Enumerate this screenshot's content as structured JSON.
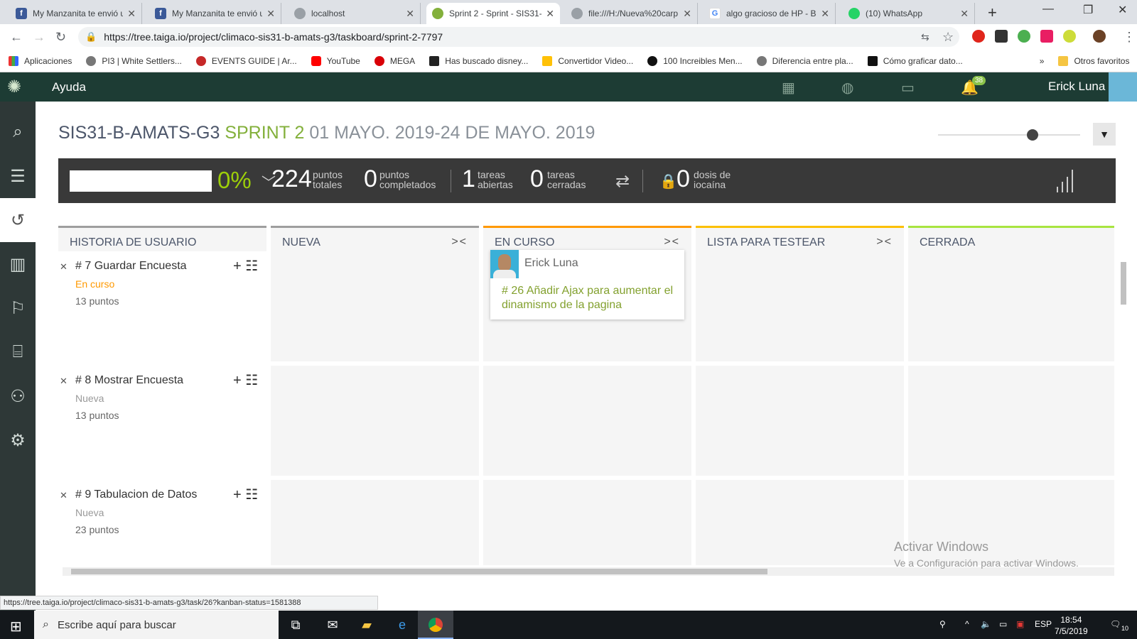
{
  "browser": {
    "tabs": [
      {
        "title": "My Manzanita te envió u",
        "icon": "facebook-icon",
        "active": false
      },
      {
        "title": "My Manzanita te envió u",
        "icon": "facebook-icon",
        "active": false
      },
      {
        "title": "localhost",
        "icon": "globe-icon",
        "active": false
      },
      {
        "title": "Sprint 2 - Sprint - SIS31-",
        "icon": "taiga-icon",
        "active": true
      },
      {
        "title": "file:///H:/Nueva%20carp",
        "icon": "globe-icon",
        "active": false
      },
      {
        "title": "algo gracioso de HP - Bu",
        "icon": "google-icon",
        "active": false
      },
      {
        "title": "(10) WhatsApp",
        "icon": "whatsapp-icon",
        "active": false
      }
    ],
    "url": "https://tree.taiga.io/project/climaco-sis31-b-amats-g3/taskboard/sprint-2-7797",
    "bookmarks": [
      "Aplicaciones",
      "PI3 | White Settlers...",
      "EVENTS GUIDE | Ar...",
      "YouTube",
      "MEGA",
      "Has buscado disney...",
      "Convertidor Video...",
      "100 Increibles Men...",
      "Diferencia entre pla...",
      "Cómo graficar dato..."
    ],
    "other_bookmarks": "Otros favoritos",
    "status_url": "https://tree.taiga.io/project/climaco-sis31-b-amats-g3/task/26?kanban-status=1581388"
  },
  "header": {
    "help": "Ayuda",
    "notifications": "38",
    "user": "Erick Luna"
  },
  "page": {
    "project": "SIS31-B-AMATS-G3",
    "sprint": "SPRINT 2",
    "dates": "01 MAYO. 2019-24 DE MAYO. 2019"
  },
  "summary": {
    "percent": "0%",
    "progress_fraction": 0,
    "total_points": "224",
    "total_label": [
      "puntos",
      "totales"
    ],
    "completed_points": "0",
    "completed_label": [
      "puntos",
      "completados"
    ],
    "open_tasks": "1",
    "open_label": [
      "tareas",
      "abiertas"
    ],
    "closed_tasks": "0",
    "closed_label": [
      "tareas",
      "cerradas"
    ],
    "iocaine": "0",
    "iocaine_label": [
      "dosis de",
      "iocaína"
    ]
  },
  "columns": [
    {
      "name": "HISTORIA DE USUARIO",
      "collapse": "",
      "color": "#9e9e9e"
    },
    {
      "name": "NUEVA",
      "collapse": "><",
      "color": "#9e9e9e"
    },
    {
      "name": "EN CURSO",
      "collapse": "><",
      "color": "#ff9900"
    },
    {
      "name": "LISTA PARA TESTEAR",
      "collapse": "><",
      "color": "#fcc000"
    },
    {
      "name": "CERRADA",
      "collapse": "",
      "color": "#a8e440"
    }
  ],
  "stories": [
    {
      "title": "# 7 Guardar Encuesta",
      "status": "En curso",
      "status_color": "#ff9900",
      "points": "13 puntos"
    },
    {
      "title": "# 8 Mostrar Encuesta",
      "status": "Nueva",
      "status_color": "#999999",
      "points": "13 puntos"
    },
    {
      "title": "# 9 Tabulacion de Datos",
      "status": "Nueva",
      "status_color": "#999999",
      "points": "23 puntos"
    }
  ],
  "task_card": {
    "user": "Erick Luna",
    "title": "# 26  Añadir Ajax para aumentar el dinamismo de la pagina"
  },
  "watermark": {
    "line1": "Activar Windows",
    "line2": "Ve a Configuración para activar Windows."
  },
  "taskbar": {
    "search_placeholder": "Escribe aquí para buscar",
    "lang": "ESP",
    "time": "18:54",
    "date": "7/5/2019",
    "notif_count": "10"
  }
}
